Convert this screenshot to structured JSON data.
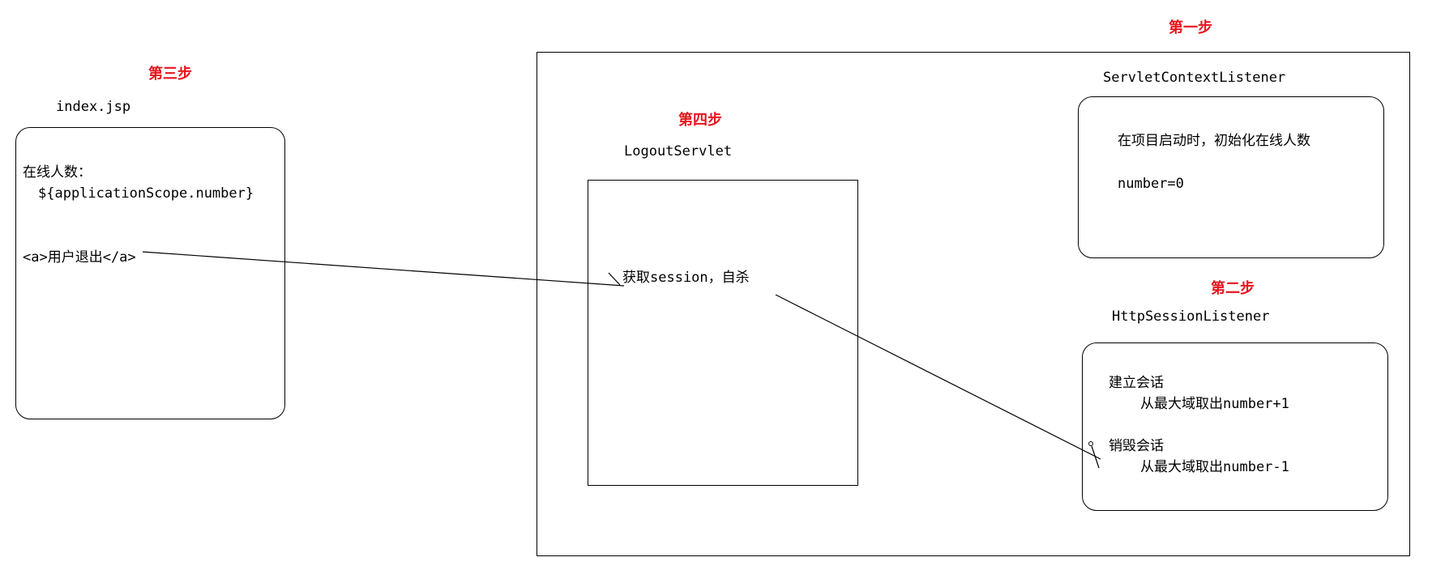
{
  "steps": {
    "step1": "第一步",
    "step2": "第二步",
    "step3": "第三步",
    "step4": "第四步"
  },
  "index_jsp": {
    "title": "index.jsp",
    "line1": "在线人数：",
    "line2": "${applicationScope.number}",
    "line3": "<a>用户退出</a>"
  },
  "logout_servlet": {
    "title": "LogoutServlet",
    "line1": "获取session，自杀"
  },
  "context_listener": {
    "title": "ServletContextListener",
    "line1": "在项目启动时，初始化在线人数",
    "line2": "number=0"
  },
  "session_listener": {
    "title": "HttpSessionListener",
    "line1": "建立会话",
    "line2": "从最大域取出number+1",
    "line3": "销毁会话",
    "line4": "从最大域取出number-1"
  },
  "colors": {
    "step_label": "#e8141d",
    "stroke": "#000000"
  }
}
